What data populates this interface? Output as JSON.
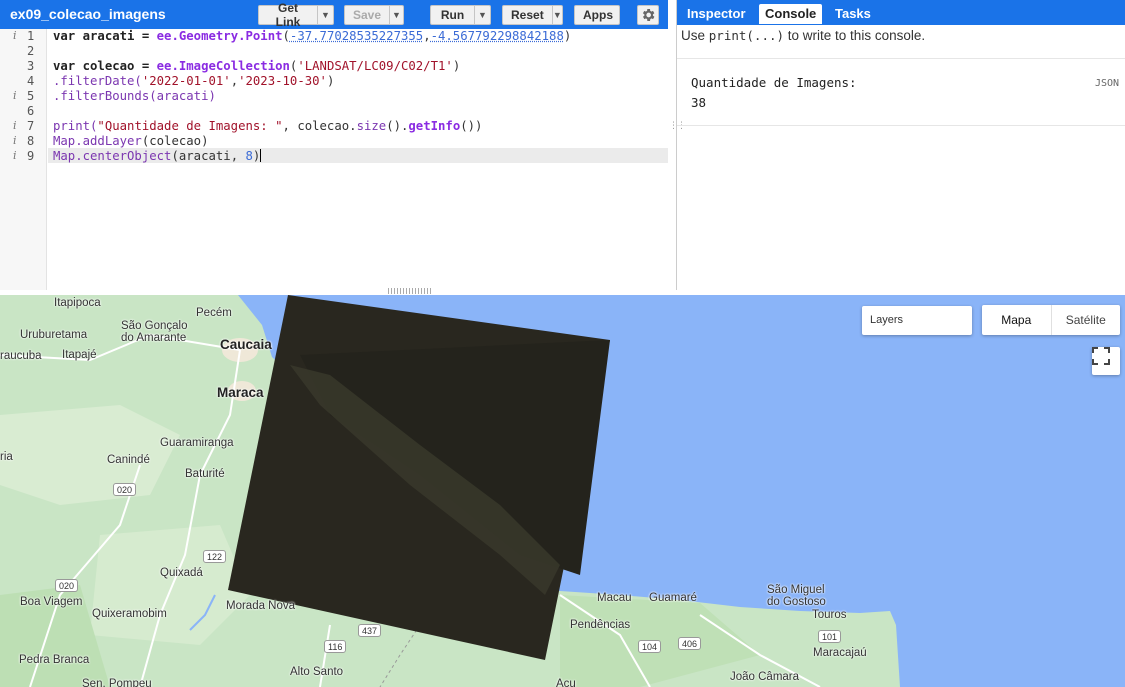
{
  "editor": {
    "script_name": "ex09_colecao_imagens",
    "buttons": {
      "get_link": "Get Link",
      "save": "Save",
      "run": "Run",
      "reset": "Reset",
      "apps": "Apps"
    },
    "line_numbers": [
      "1",
      "2",
      "3",
      "4",
      "5",
      "6",
      "7",
      "8",
      "9"
    ],
    "code": {
      "l1": {
        "a": "var aracati = ",
        "b": "ee.Geometry.Point",
        "c": "(",
        "d": "-37.77028535227355",
        "e": ",",
        "f": "-4.567792298842188",
        "g": ")"
      },
      "l3": {
        "a": "var colecao = ",
        "b": "ee.ImageCollection",
        "c": "(",
        "d": "'LANDSAT/LC09/C02/T1'",
        "e": ")"
      },
      "l4": {
        "a": ".filterDate(",
        "b": "'2022-01-01'",
        "c": ",",
        "d": "'2023-10-30'",
        "e": ")"
      },
      "l5": {
        "a": ".filterBounds(aracati)"
      },
      "l7": {
        "a": "print(",
        "b": "\"Quantidade de Imagens: \"",
        "c": ", colecao.",
        "d": "size",
        "e": "().",
        "f": "getInfo",
        "g": "())"
      },
      "l8": {
        "a": "Map.addLayer",
        "b": "(colecao)"
      },
      "l9": {
        "a": "Map.centerObject",
        "b": "(aracati, ",
        "c": "8",
        "d": ")"
      }
    }
  },
  "right_panel": {
    "tabs": [
      "Inspector",
      "Console",
      "Tasks"
    ],
    "active_tab": "Console",
    "hint_pre": "Use ",
    "hint_code": "print(...)",
    "hint_post": " to write to this console.",
    "output_label": "Quantidade de Imagens:",
    "output_value": "38",
    "json_tag": "JSON"
  },
  "map": {
    "layers_label": "Layers",
    "map_types": [
      "Mapa",
      "Satélite"
    ],
    "active_map_type": "Mapa",
    "places": [
      "Itapipoca",
      "Pecém",
      "Uruburetama",
      "São Gonçalo",
      "do Amarante",
      "Caucaia",
      "raucuba",
      "Itapajé",
      "Maraca",
      "Guaramiranga",
      "Canindé",
      "Baturité",
      "Quixadá",
      "Boa Viagem",
      "Quixeramobim",
      "Morada Nova",
      "Pedra Branca",
      "Sen. Pompeu",
      "Alto Santo",
      "Acu",
      "Macau",
      "Guamaré",
      "São Miguel",
      "do Gostoso",
      "Touros",
      "Pendências",
      "Maracajaú",
      "João Câmara",
      "ria"
    ],
    "roads": [
      "020",
      "122",
      "020",
      "116",
      "437",
      "104",
      "406",
      "101"
    ],
    "colors": {
      "water": "#8ab4f8",
      "land": "#c9e5c5",
      "raster": "#29271f"
    }
  }
}
